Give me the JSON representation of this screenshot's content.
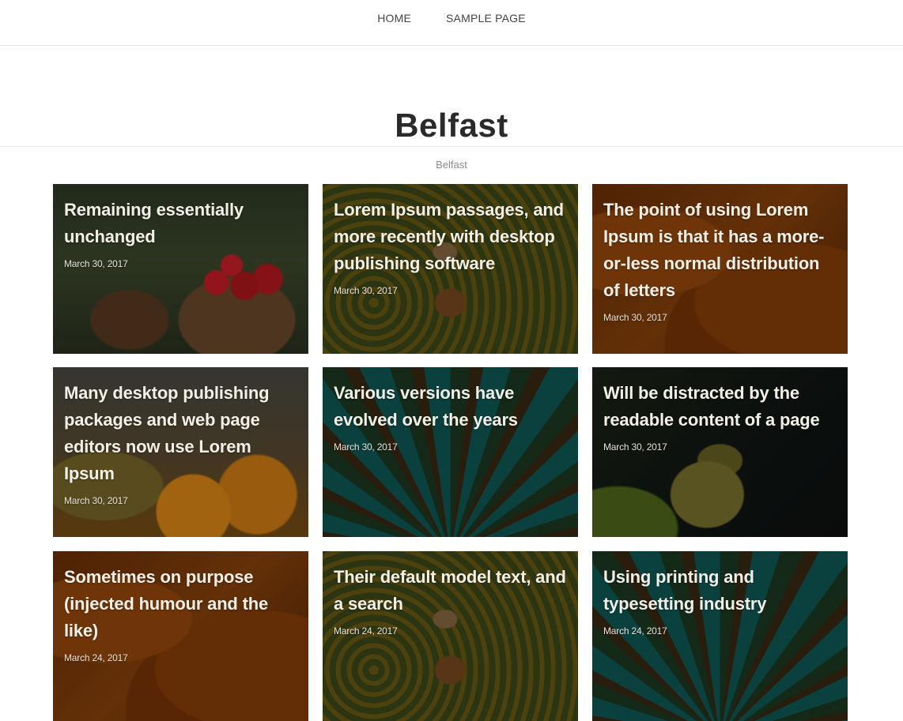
{
  "nav": {
    "items": [
      {
        "label": "HOME"
      },
      {
        "label": "SAMPLE PAGE"
      }
    ]
  },
  "site": {
    "title": "Belfast",
    "description": "Belfast"
  },
  "posts": [
    {
      "title": "Remaining essentially unchanged",
      "date": "March 30, 2017",
      "image": "apples-barrel"
    },
    {
      "title": "Lorem Ipsum passages, and more recently with desktop publishing software",
      "date": "March 30, 2017",
      "image": "sunflower-field"
    },
    {
      "title": "The point of using Lorem Ipsum is that it has a more-or-less normal distribution of letters",
      "date": "March 30, 2017",
      "image": "pumpkins"
    },
    {
      "title": "Many desktop publishing packages and web page editors now use Lorem Ipsum",
      "date": "March 30, 2017",
      "image": "oranges"
    },
    {
      "title": "Various versions have evolved over the years",
      "date": "March 30, 2017",
      "image": "palm-trees"
    },
    {
      "title": "Will be distracted by the readable content of a page",
      "date": "March 30, 2017",
      "image": "grapes"
    },
    {
      "title": "Sometimes on purpose (injected humour and the like)",
      "date": "March 24, 2017",
      "image": "pumpkins"
    },
    {
      "title": "Their default model text, and a search",
      "date": "March 24, 2017",
      "image": "sunflower-field"
    },
    {
      "title": "Using printing and typesetting industry",
      "date": "March 24, 2017",
      "image": "palm-trees"
    }
  ]
}
